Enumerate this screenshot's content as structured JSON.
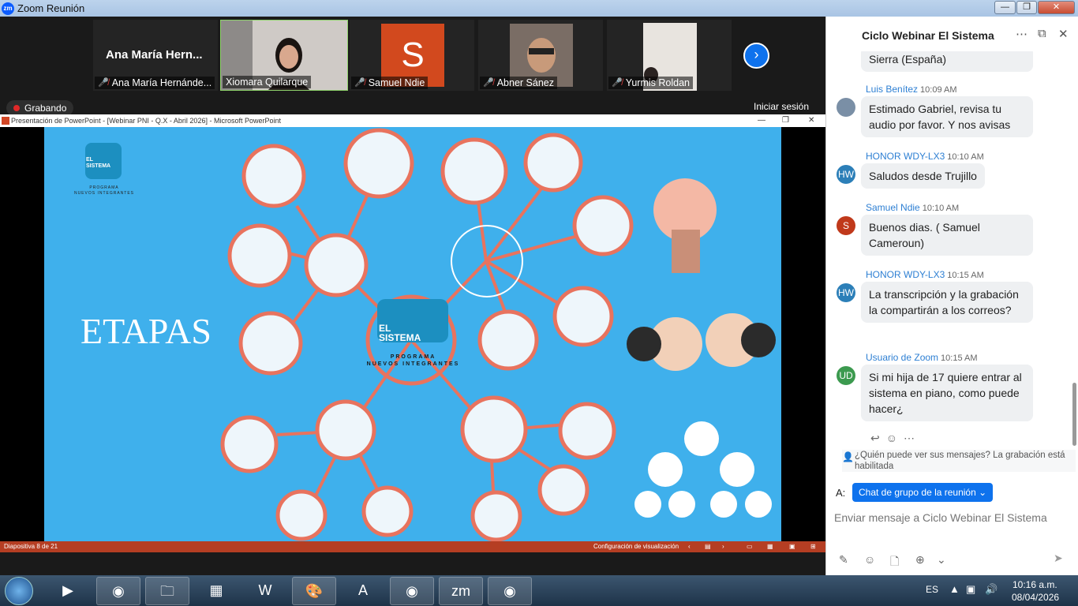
{
  "window": {
    "title": "Zoom Reunión",
    "minimize": "—",
    "maximize": "❐",
    "close": "✕"
  },
  "participants": [
    {
      "name": "Ana María Hernánde...",
      "big_name": "Ana María Hern...",
      "muted": true
    },
    {
      "name": "Xiomara Quilarque",
      "muted": false,
      "active": true
    },
    {
      "name": "Samuel Ndie",
      "avatar_letter": "S",
      "muted": true
    },
    {
      "name": "Abner Sánez",
      "muted": true
    },
    {
      "name": "Yurmis Roldan",
      "muted": true
    }
  ],
  "recording_label": "Grabando",
  "login_label": "Iniciar sesión",
  "ppt": {
    "window_title": "Presentación de PowerPoint - [Webinar PNI - Q.X - Abril 2026] - Microsoft PowerPoint",
    "slide_status": "Diapositiva 8 de 21",
    "view_settings": "Configuración de visualización"
  },
  "slide": {
    "heading": "ETAPAS",
    "logo_small_line1": "EL",
    "logo_small_line2": "SISTEMA",
    "logo_small_sub1": "PROGRAMA",
    "logo_small_sub2": "NUEVOS INTEGRANTES",
    "logo_center_line1": "EL",
    "logo_center_line2": "SISTEMA",
    "logo_center_sub1": "PROGRAMA",
    "logo_center_sub2": "NUEVOS INTEGRANTES"
  },
  "chat": {
    "title": "Ciclo Webinar El Sistema",
    "messages": [
      {
        "sender": "",
        "time": "",
        "text": "Sierra (España)"
      },
      {
        "sender": "Luis Benítez",
        "time": "10:09 AM",
        "text": "Estimado Gabriel, revisa tu audio por favor. Y nos avisas",
        "avatar": ""
      },
      {
        "sender": "HONOR WDY-LX3",
        "time": "10:10 AM",
        "text": "Saludos desde Trujillo",
        "avatar": "HW"
      },
      {
        "sender": "Samuel Ndie",
        "time": "10:10 AM",
        "text": "Buenos dias. ( Samuel Cameroun)",
        "avatar": "S"
      },
      {
        "sender": "HONOR WDY-LX3",
        "time": "10:15 AM",
        "text": "La transcripción y la grabación la compartirán a los correos?",
        "avatar": "HW"
      },
      {
        "sender": "Usuario de Zoom",
        "time": "10:15 AM",
        "text": "Si mi hija de 17 quiere entrar al sistema en piano, como puede hacer¿",
        "avatar": "UD"
      }
    ],
    "visibility_note": "¿Quién puede ver sus mensajes? La grabación está habilitada",
    "to_label": "A:",
    "to_value": "Chat de grupo de la reunión",
    "input_placeholder": "Enviar mensaje a Ciclo Webinar El Sistema"
  },
  "taskbar": {
    "language": "ES",
    "time": "10:16 a.m.",
    "date": "08/04/2026"
  },
  "colors": {
    "slide_bg": "#3fb0ec",
    "circle_stroke": "#e8735e",
    "zoom_blue": "#0e72ed"
  }
}
